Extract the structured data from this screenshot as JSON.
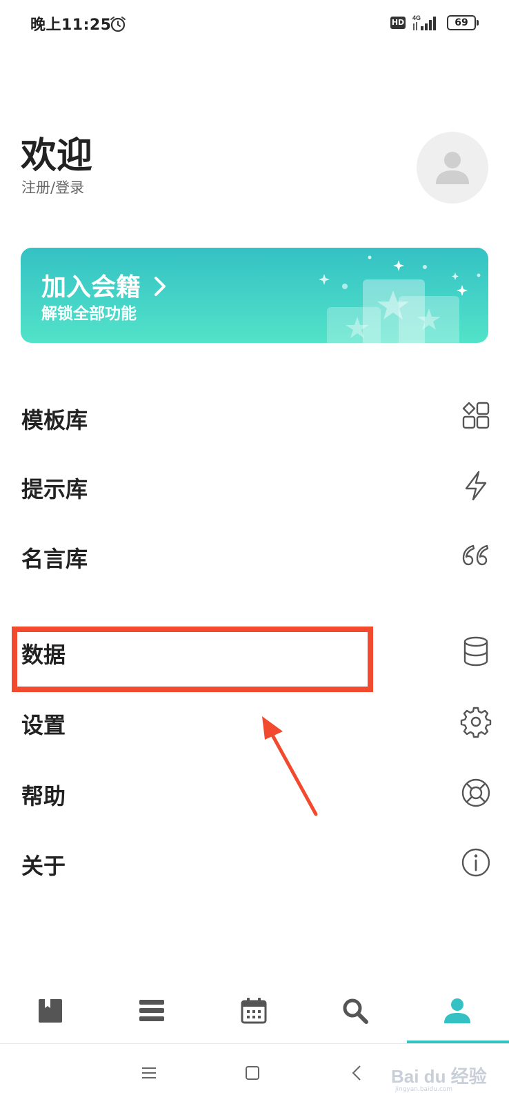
{
  "status_bar": {
    "time": "晚上11:25",
    "hd_label": "HD",
    "network_label": "4G",
    "battery": "69"
  },
  "profile": {
    "title": "欢迎",
    "login_label": "注册/登录"
  },
  "member_banner": {
    "title": "加入会籍",
    "subtitle": "解锁全部功能",
    "accent_from": "#34c1c4",
    "accent_to": "#52e3c9"
  },
  "menu": {
    "items": [
      {
        "label": "模板库",
        "icon": "grid-icon"
      },
      {
        "label": "提示库",
        "icon": "lightning-icon"
      },
      {
        "label": "名言库",
        "icon": "quote-icon"
      },
      {
        "label": "数据",
        "icon": "database-icon"
      },
      {
        "label": "设置",
        "icon": "gear-icon"
      },
      {
        "label": "帮助",
        "icon": "lifebuoy-icon"
      },
      {
        "label": "关于",
        "icon": "info-icon"
      }
    ]
  },
  "annotation": {
    "highlight_color": "#f14a2e"
  },
  "tab_bar": {
    "tabs": [
      {
        "icon": "notebook-icon"
      },
      {
        "icon": "list-icon"
      },
      {
        "icon": "calendar-icon"
      },
      {
        "icon": "search-icon"
      },
      {
        "icon": "person-icon"
      }
    ],
    "active_index": 4,
    "active_color": "#34c1c4"
  },
  "watermark": {
    "text": "Bai du 经验",
    "sub": "jingyan.baidu.com"
  }
}
